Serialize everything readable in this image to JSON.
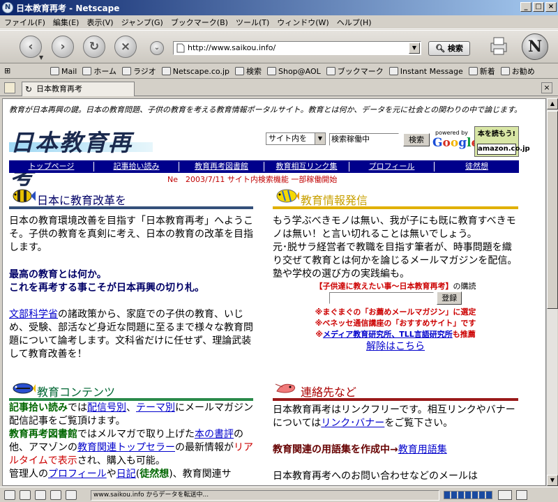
{
  "window": {
    "title": "日本教育再考 - Netscape",
    "brand_letter": "N"
  },
  "menu": [
    "ファイル(F)",
    "編集(E)",
    "表示(V)",
    "ジャンプ(G)",
    "ブックマーク(B)",
    "ツール(T)",
    "ウィンドウ(W)",
    "ヘルプ(H)"
  ],
  "toolbar": {
    "url": "http://www.saikou.info/",
    "search_label": "検索"
  },
  "personal_toolbar": [
    "Mail",
    "ホーム",
    "ラジオ",
    "Netscape.co.jp",
    "検索",
    "Shop@AOL",
    "ブックマーク",
    "Instant Message",
    "新着",
    "お勧め"
  ],
  "tab": {
    "title": "日本教育再考"
  },
  "page": {
    "description": "教育が日本再興の鍵。日本の教育問題、子供の教育を考える教育情報ポータルサイト。教育とは何か、データを元に社会との関わりの中で論じます。",
    "logo_text": "日本教育再考",
    "site_select": "サイト内を",
    "search_value": "検索稼働中",
    "search_button": "検索",
    "powered_by": "powered by",
    "google": "Google",
    "amazon_top": "本を読もう!",
    "amazon_bottom": "amazon.co.jp",
    "nav": [
      "トップページ",
      "記事拾い読み",
      "教育再考図書館",
      "教育相互リンク集",
      "プロフィール",
      "徒然想"
    ],
    "news": "Ne　2003/7/11 サイト内検索機能 一部稼働開始",
    "sec1": {
      "title": "日本に教育改革を",
      "p1": "日本の教育環境改善を目指す「日本教育再考」へようこそ。子供の教育を真剣に考え、日本の教育の改革を目指します。",
      "h1": "最高の教育とは何か。",
      "h2": "これを再考する事こそが日本再興の切り札。",
      "link": "文部科学省",
      "p2": "の諸政策から、家庭での子供の教育、いじめ、受験、部活など身近な問題に至るまで様々な教育問題について論考します。文科省だけに任せず、理論武装して教育改善を！"
    },
    "sec2": {
      "title": "教育情報発信",
      "p1": "もう学ぶべきモノは無い、我が子にも既に教育すべきモノは無い！と言い切れることは無いでしょう。",
      "p2": "元･脱サラ経営者で教職を目指す筆者が、時事問題を織り交ぜて教育とは何かを論じるメールマガジンを配信。塾や学校の選び方の実践編も。",
      "mag": "【子供達に教えたい事～日本教育再考】",
      "mag_tail": "の購読",
      "register": "登録",
      "a1": "※まぐまぐの「お薦めメールマガジン」に選定",
      "a2": "※ベネッセ通信講座の「おすすめサイト」です",
      "a3_pre": "※",
      "a3_link": "メディア教育研究所、TLL言語研究所",
      "a3_post": "も推薦",
      "unsub": "解除はこちら"
    },
    "sec3": {
      "title": "教育コンテンツ",
      "b1": "記事拾い読み",
      "t1": "では",
      "l1": "配信号別",
      "t2": "、",
      "l2": "テーマ別",
      "t3": "にメールマガジン配信記事をご覧頂けます。",
      "b2": "教育再考図書館",
      "t4": "ではメルマガで取り上げた",
      "l3": "本の書評",
      "t5": "の他、アマゾンの",
      "l4": "教育関連トップセラー",
      "t6": "の最新情報が",
      "r1": "リアルタイムで表示",
      "t7": "され、購入も可能。",
      "t8": "管理人の",
      "l5": "プロフィール",
      "t9": "や",
      "l6": "日記",
      "t10": "(",
      "b3": "徒然想",
      "t11": ")、教育関連サ"
    },
    "sec4": {
      "title": "連絡先など",
      "p1": "日本教育再考はリンクフリーです。相互リンクやバナーについては",
      "link": "リンク･バナー",
      "p1b": "をご覧下さい。",
      "h": "教育関連の用語集を作成中→",
      "hlink": "教育用語集",
      "p2": "日本教育再考へのお問い合わせなどのメールは"
    }
  },
  "status": {
    "text": "www.saikou.info からデータを転送中..."
  }
}
